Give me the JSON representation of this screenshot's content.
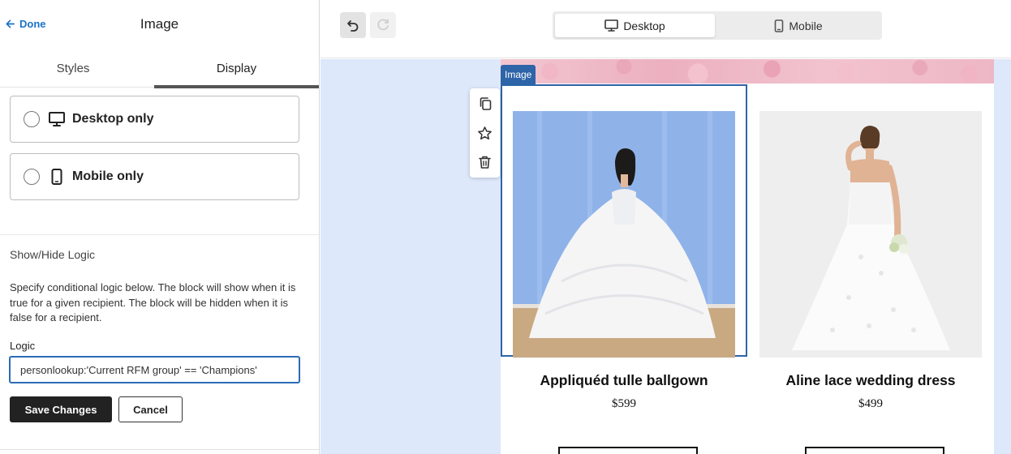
{
  "left_panel": {
    "done_label": "Done",
    "title": "Image",
    "tabs": [
      {
        "label": "Styles",
        "active": false
      },
      {
        "label": "Display",
        "active": true
      }
    ],
    "display_options": [
      {
        "label": "Desktop only",
        "icon": "desktop-icon",
        "selected": false
      },
      {
        "label": "Mobile only",
        "icon": "mobile-icon",
        "selected": false
      }
    ],
    "logic_section": {
      "heading": "Show/Hide Logic",
      "description": "Specify conditional logic below. The block will show when it is true for a given recipient. The block will be hidden when it is false for a recipient.",
      "field_label": "Logic",
      "field_value": "personlookup:'Current RFM group' == 'Champions'"
    },
    "save_label": "Save Changes",
    "cancel_label": "Cancel"
  },
  "preview_toolbar": {
    "undo_icon": "undo-icon",
    "redo_icon": "redo-icon",
    "device_toggle": [
      {
        "label": "Desktop",
        "icon": "desktop-icon",
        "active": true
      },
      {
        "label": "Mobile",
        "icon": "mobile-icon",
        "active": false
      }
    ]
  },
  "canvas": {
    "selected_block_tag": "Image",
    "block_tools": [
      "copy-icon",
      "star-icon",
      "trash-icon"
    ],
    "products": [
      {
        "name": "Appliquéd tulle ballgown",
        "price": "$599"
      },
      {
        "name": "Aline lace wedding dress",
        "price": "$499"
      }
    ]
  },
  "colors": {
    "accent_blue": "#2e64a8",
    "link_blue": "#1a73c8",
    "canvas_bg": "#dde8fb",
    "primary_button": "#222222"
  }
}
